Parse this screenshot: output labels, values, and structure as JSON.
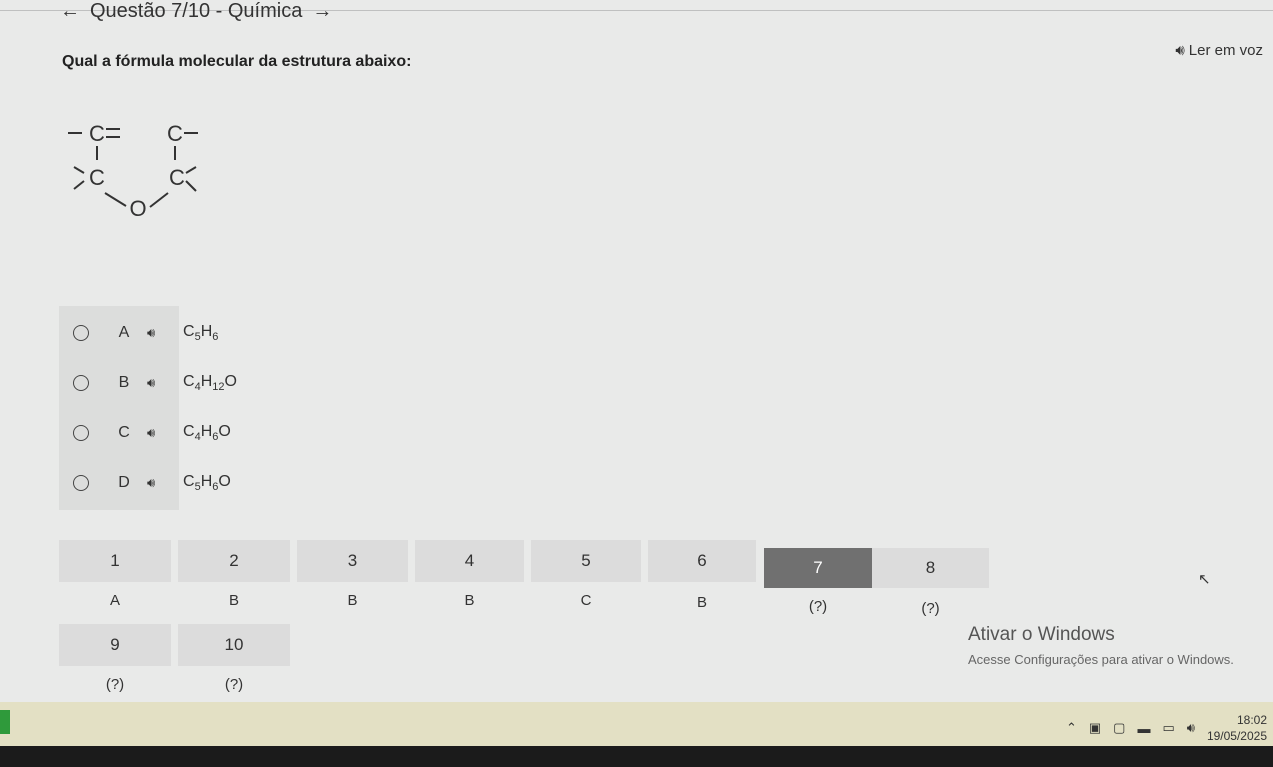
{
  "header": {
    "question_title": "Questão 7/10 - Química",
    "tts_label": "Ler em voz"
  },
  "question": {
    "text": "Qual a fórmula molecular da estrutura abaixo:",
    "structure_labels": {
      "c1": "C",
      "c2": "C",
      "c3": "C",
      "c4": "C",
      "o": "O"
    }
  },
  "options": [
    {
      "letter": "A",
      "base1": "C",
      "sub1": "5",
      "base2": "H",
      "sub2": "6",
      "tail": ""
    },
    {
      "letter": "B",
      "base1": "C",
      "sub1": "4",
      "base2": "H",
      "sub2": "12",
      "tail": "O"
    },
    {
      "letter": "C",
      "base1": "C",
      "sub1": "4",
      "base2": "H",
      "sub2": "6",
      "tail": "O"
    },
    {
      "letter": "D",
      "base1": "C",
      "sub1": "5",
      "base2": "H",
      "sub2": "6",
      "tail": "O"
    }
  ],
  "navigator": {
    "numbers": [
      "1",
      "2",
      "3",
      "4",
      "5",
      "6",
      "7",
      "8",
      "9",
      "10"
    ],
    "answers": [
      "A",
      "B",
      "B",
      "B",
      "C",
      "B",
      "(?)",
      "(?)",
      "(?)",
      "(?)"
    ],
    "active": "7"
  },
  "watermark": {
    "title": "Ativar o Windows",
    "subtitle": "Acesse Configurações para ativar o Windows."
  },
  "taskbar": {
    "time": "18:02",
    "date": "19/05/2025"
  }
}
